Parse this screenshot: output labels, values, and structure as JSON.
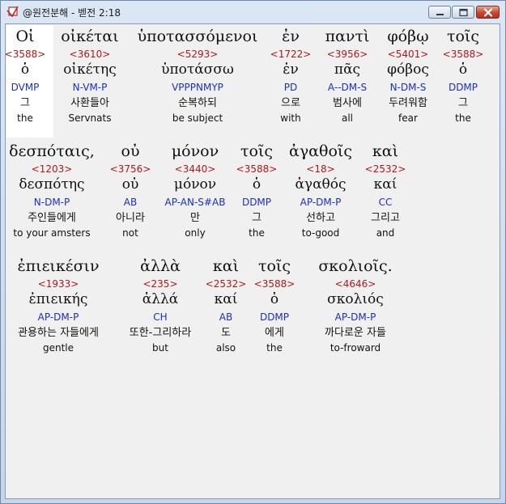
{
  "window": {
    "title": "@원전분해 - 벧전 2:18",
    "buttons": {
      "minimize": "minimize-icon",
      "maximize": "maximize-icon",
      "close": "close-icon"
    }
  },
  "colors": {
    "strong_number": "#b01818",
    "morphology": "#1a2fc8",
    "text": "#111111",
    "selection": "#ffffff"
  },
  "lines": [
    {
      "words": [
        {
          "greek": "Οἱ",
          "strong": "<3588>",
          "lemma": "ὁ",
          "morph": "DVMP",
          "korean": "그",
          "english": "the"
        },
        {
          "greek": "οἰκέται",
          "strong": "<3610>",
          "lemma": "οἰκέτης",
          "morph": "N-VM-P",
          "korean": "사환들아",
          "english": "Servnats"
        },
        {
          "greek": "ὑποτασσόμενοι",
          "strong": "<5293>",
          "lemma": "ὑποτάσσω",
          "morph": "VPPPNMYP",
          "korean": "순복하되",
          "english": "be subject"
        },
        {
          "greek": "ἐν",
          "strong": "<1722>",
          "lemma": "ἐν",
          "morph": "PD",
          "korean": "으로",
          "english": "with"
        },
        {
          "greek": "παντὶ",
          "strong": "<3956>",
          "lemma": "πᾶς",
          "morph": "A--DM-S",
          "korean": "범사에",
          "english": "all"
        },
        {
          "greek": "φόβῳ",
          "strong": "<5401>",
          "lemma": "φόβος",
          "morph": "N-DM-S",
          "korean": "두려워함",
          "english": "fear"
        },
        {
          "greek": "τοῖς",
          "strong": "<3588>",
          "lemma": "ὁ",
          "morph": "DDMP",
          "korean": "그",
          "english": "the"
        }
      ]
    },
    {
      "words": [
        {
          "greek": "δεσπόταις,",
          "strong": "<1203>",
          "lemma": "δεσπότης",
          "morph": "N-DM-P",
          "korean": "주인들에게",
          "english": "to your amsters"
        },
        {
          "greek": "οὐ",
          "strong": "<3756>",
          "lemma": "οὐ",
          "morph": "AB",
          "korean": "아니라",
          "english": "not"
        },
        {
          "greek": "μόνον",
          "strong": "<3440>",
          "lemma": "μόνον",
          "morph": "AP-AN-S#AB",
          "korean": "만",
          "english": "only"
        },
        {
          "greek": "τοῖς",
          "strong": "<3588>",
          "lemma": "ὁ",
          "morph": "DDMP",
          "korean": "그",
          "english": "the"
        },
        {
          "greek": "ἀγαθοῖς",
          "strong": "<18>",
          "lemma": "ἀγαθός",
          "morph": "AP-DM-P",
          "korean": "선하고",
          "english": "to-good"
        },
        {
          "greek": "καὶ",
          "strong": "<2532>",
          "lemma": "καί",
          "morph": "CC",
          "korean": "그리고",
          "english": "and"
        }
      ]
    },
    {
      "words": [
        {
          "greek": "ἐπιεικέσιν",
          "strong": "<1933>",
          "lemma": "ἐπιεικής",
          "morph": "AP-DM-P",
          "korean": "관용하는 자들에게",
          "english": "gentle"
        },
        {
          "greek": "ἀλλὰ",
          "strong": "<235>",
          "lemma": "ἀλλά",
          "morph": "CH",
          "korean": "또한-그리하라",
          "english": "but"
        },
        {
          "greek": "καὶ",
          "strong": "<2532>",
          "lemma": "καί",
          "morph": "AB",
          "korean": "도",
          "english": "also"
        },
        {
          "greek": "τοῖς",
          "strong": "<3588>",
          "lemma": "ὁ",
          "morph": "DDMP",
          "korean": "에게",
          "english": "the"
        },
        {
          "greek": "σκολιοῖς.",
          "strong": "<4646>",
          "lemma": "σκολιός",
          "morph": "AP-DM-P",
          "korean": "까다로운 자들",
          "english": "to-froward"
        }
      ]
    }
  ]
}
